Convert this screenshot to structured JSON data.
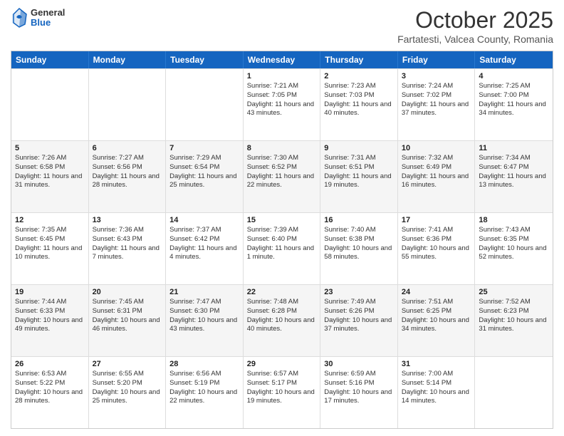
{
  "header": {
    "logo_general": "General",
    "logo_blue": "Blue",
    "month_title": "October 2025",
    "location": "Fartatesti, Valcea County, Romania"
  },
  "weekdays": [
    "Sunday",
    "Monday",
    "Tuesday",
    "Wednesday",
    "Thursday",
    "Friday",
    "Saturday"
  ],
  "rows": [
    [
      {
        "day": "",
        "info": ""
      },
      {
        "day": "",
        "info": ""
      },
      {
        "day": "",
        "info": ""
      },
      {
        "day": "1",
        "info": "Sunrise: 7:21 AM\nSunset: 7:05 PM\nDaylight: 11 hours and 43 minutes."
      },
      {
        "day": "2",
        "info": "Sunrise: 7:23 AM\nSunset: 7:03 PM\nDaylight: 11 hours and 40 minutes."
      },
      {
        "day": "3",
        "info": "Sunrise: 7:24 AM\nSunset: 7:02 PM\nDaylight: 11 hours and 37 minutes."
      },
      {
        "day": "4",
        "info": "Sunrise: 7:25 AM\nSunset: 7:00 PM\nDaylight: 11 hours and 34 minutes."
      }
    ],
    [
      {
        "day": "5",
        "info": "Sunrise: 7:26 AM\nSunset: 6:58 PM\nDaylight: 11 hours and 31 minutes."
      },
      {
        "day": "6",
        "info": "Sunrise: 7:27 AM\nSunset: 6:56 PM\nDaylight: 11 hours and 28 minutes."
      },
      {
        "day": "7",
        "info": "Sunrise: 7:29 AM\nSunset: 6:54 PM\nDaylight: 11 hours and 25 minutes."
      },
      {
        "day": "8",
        "info": "Sunrise: 7:30 AM\nSunset: 6:52 PM\nDaylight: 11 hours and 22 minutes."
      },
      {
        "day": "9",
        "info": "Sunrise: 7:31 AM\nSunset: 6:51 PM\nDaylight: 11 hours and 19 minutes."
      },
      {
        "day": "10",
        "info": "Sunrise: 7:32 AM\nSunset: 6:49 PM\nDaylight: 11 hours and 16 minutes."
      },
      {
        "day": "11",
        "info": "Sunrise: 7:34 AM\nSunset: 6:47 PM\nDaylight: 11 hours and 13 minutes."
      }
    ],
    [
      {
        "day": "12",
        "info": "Sunrise: 7:35 AM\nSunset: 6:45 PM\nDaylight: 11 hours and 10 minutes."
      },
      {
        "day": "13",
        "info": "Sunrise: 7:36 AM\nSunset: 6:43 PM\nDaylight: 11 hours and 7 minutes."
      },
      {
        "day": "14",
        "info": "Sunrise: 7:37 AM\nSunset: 6:42 PM\nDaylight: 11 hours and 4 minutes."
      },
      {
        "day": "15",
        "info": "Sunrise: 7:39 AM\nSunset: 6:40 PM\nDaylight: 11 hours and 1 minute."
      },
      {
        "day": "16",
        "info": "Sunrise: 7:40 AM\nSunset: 6:38 PM\nDaylight: 10 hours and 58 minutes."
      },
      {
        "day": "17",
        "info": "Sunrise: 7:41 AM\nSunset: 6:36 PM\nDaylight: 10 hours and 55 minutes."
      },
      {
        "day": "18",
        "info": "Sunrise: 7:43 AM\nSunset: 6:35 PM\nDaylight: 10 hours and 52 minutes."
      }
    ],
    [
      {
        "day": "19",
        "info": "Sunrise: 7:44 AM\nSunset: 6:33 PM\nDaylight: 10 hours and 49 minutes."
      },
      {
        "day": "20",
        "info": "Sunrise: 7:45 AM\nSunset: 6:31 PM\nDaylight: 10 hours and 46 minutes."
      },
      {
        "day": "21",
        "info": "Sunrise: 7:47 AM\nSunset: 6:30 PM\nDaylight: 10 hours and 43 minutes."
      },
      {
        "day": "22",
        "info": "Sunrise: 7:48 AM\nSunset: 6:28 PM\nDaylight: 10 hours and 40 minutes."
      },
      {
        "day": "23",
        "info": "Sunrise: 7:49 AM\nSunset: 6:26 PM\nDaylight: 10 hours and 37 minutes."
      },
      {
        "day": "24",
        "info": "Sunrise: 7:51 AM\nSunset: 6:25 PM\nDaylight: 10 hours and 34 minutes."
      },
      {
        "day": "25",
        "info": "Sunrise: 7:52 AM\nSunset: 6:23 PM\nDaylight: 10 hours and 31 minutes."
      }
    ],
    [
      {
        "day": "26",
        "info": "Sunrise: 6:53 AM\nSunset: 5:22 PM\nDaylight: 10 hours and 28 minutes."
      },
      {
        "day": "27",
        "info": "Sunrise: 6:55 AM\nSunset: 5:20 PM\nDaylight: 10 hours and 25 minutes."
      },
      {
        "day": "28",
        "info": "Sunrise: 6:56 AM\nSunset: 5:19 PM\nDaylight: 10 hours and 22 minutes."
      },
      {
        "day": "29",
        "info": "Sunrise: 6:57 AM\nSunset: 5:17 PM\nDaylight: 10 hours and 19 minutes."
      },
      {
        "day": "30",
        "info": "Sunrise: 6:59 AM\nSunset: 5:16 PM\nDaylight: 10 hours and 17 minutes."
      },
      {
        "day": "31",
        "info": "Sunrise: 7:00 AM\nSunset: 5:14 PM\nDaylight: 10 hours and 14 minutes."
      },
      {
        "day": "",
        "info": ""
      }
    ]
  ]
}
